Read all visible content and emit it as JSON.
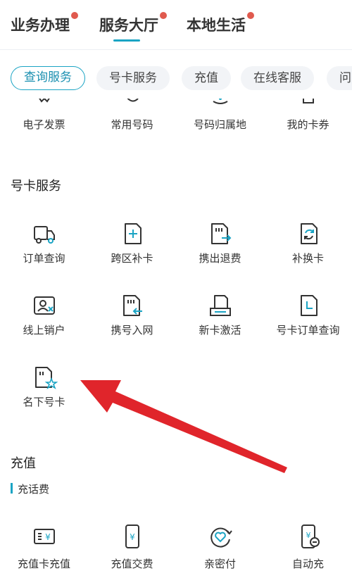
{
  "top_tabs": [
    {
      "label": "业务办理"
    },
    {
      "label": "服务大厅"
    },
    {
      "label": "本地生活"
    }
  ],
  "chips": [
    {
      "label": "查询服务"
    },
    {
      "label": "号卡服务"
    },
    {
      "label": "充值"
    },
    {
      "label": "在线客服"
    },
    {
      "label": "问"
    }
  ],
  "query_row": [
    {
      "label": "电子发票",
      "icon": "invoice-icon"
    },
    {
      "label": "常用号码",
      "icon": "phone-icon"
    },
    {
      "label": "号码归属地",
      "icon": "location-icon"
    },
    {
      "label": "我的卡券",
      "icon": "coupon-icon"
    }
  ],
  "card_section": {
    "title": "号卡服务",
    "items": [
      {
        "label": "订单查询",
        "icon": "truck-icon"
      },
      {
        "label": "跨区补卡",
        "icon": "sim-add-icon"
      },
      {
        "label": "携出退费",
        "icon": "sim-transfer-out-icon"
      },
      {
        "label": "补换卡",
        "icon": "sim-replace-icon"
      },
      {
        "label": "线上销户",
        "icon": "id-card-close-icon"
      },
      {
        "label": "携号入网",
        "icon": "sim-transfer-in-icon"
      },
      {
        "label": "新卡激活",
        "icon": "sim-activate-icon"
      },
      {
        "label": "号卡订单查询",
        "icon": "sim-order-icon"
      },
      {
        "label": "名下号卡",
        "icon": "sim-star-icon"
      }
    ]
  },
  "recharge_section": {
    "title": "充值",
    "subtitle": "充话费",
    "items": [
      {
        "label": "充值卡充值",
        "icon": "recharge-card-icon"
      },
      {
        "label": "充值交费",
        "icon": "phone-yuan-icon"
      },
      {
        "label": "亲密付",
        "icon": "heart-pay-icon"
      },
      {
        "label": "自动充",
        "icon": "auto-recharge-icon"
      }
    ]
  },
  "colors": {
    "accent": "#1aa4c4",
    "badge": "#e05a4e",
    "arrow": "#e0252b"
  }
}
